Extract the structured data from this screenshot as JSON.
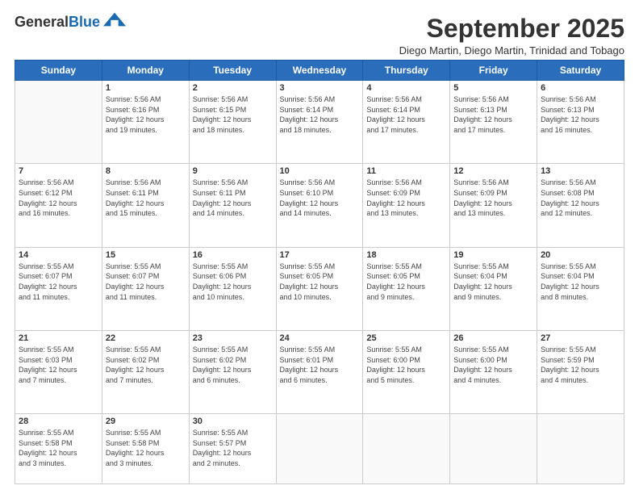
{
  "header": {
    "logo_general": "General",
    "logo_blue": "Blue",
    "month_title": "September 2025",
    "subtitle": "Diego Martin, Diego Martin, Trinidad and Tobago"
  },
  "weekdays": [
    "Sunday",
    "Monday",
    "Tuesday",
    "Wednesday",
    "Thursday",
    "Friday",
    "Saturday"
  ],
  "weeks": [
    [
      {
        "day": "",
        "info": ""
      },
      {
        "day": "1",
        "info": "Sunrise: 5:56 AM\nSunset: 6:16 PM\nDaylight: 12 hours\nand 19 minutes."
      },
      {
        "day": "2",
        "info": "Sunrise: 5:56 AM\nSunset: 6:15 PM\nDaylight: 12 hours\nand 18 minutes."
      },
      {
        "day": "3",
        "info": "Sunrise: 5:56 AM\nSunset: 6:14 PM\nDaylight: 12 hours\nand 18 minutes."
      },
      {
        "day": "4",
        "info": "Sunrise: 5:56 AM\nSunset: 6:14 PM\nDaylight: 12 hours\nand 17 minutes."
      },
      {
        "day": "5",
        "info": "Sunrise: 5:56 AM\nSunset: 6:13 PM\nDaylight: 12 hours\nand 17 minutes."
      },
      {
        "day": "6",
        "info": "Sunrise: 5:56 AM\nSunset: 6:13 PM\nDaylight: 12 hours\nand 16 minutes."
      }
    ],
    [
      {
        "day": "7",
        "info": "Sunrise: 5:56 AM\nSunset: 6:12 PM\nDaylight: 12 hours\nand 16 minutes."
      },
      {
        "day": "8",
        "info": "Sunrise: 5:56 AM\nSunset: 6:11 PM\nDaylight: 12 hours\nand 15 minutes."
      },
      {
        "day": "9",
        "info": "Sunrise: 5:56 AM\nSunset: 6:11 PM\nDaylight: 12 hours\nand 14 minutes."
      },
      {
        "day": "10",
        "info": "Sunrise: 5:56 AM\nSunset: 6:10 PM\nDaylight: 12 hours\nand 14 minutes."
      },
      {
        "day": "11",
        "info": "Sunrise: 5:56 AM\nSunset: 6:09 PM\nDaylight: 12 hours\nand 13 minutes."
      },
      {
        "day": "12",
        "info": "Sunrise: 5:56 AM\nSunset: 6:09 PM\nDaylight: 12 hours\nand 13 minutes."
      },
      {
        "day": "13",
        "info": "Sunrise: 5:56 AM\nSunset: 6:08 PM\nDaylight: 12 hours\nand 12 minutes."
      }
    ],
    [
      {
        "day": "14",
        "info": "Sunrise: 5:55 AM\nSunset: 6:07 PM\nDaylight: 12 hours\nand 11 minutes."
      },
      {
        "day": "15",
        "info": "Sunrise: 5:55 AM\nSunset: 6:07 PM\nDaylight: 12 hours\nand 11 minutes."
      },
      {
        "day": "16",
        "info": "Sunrise: 5:55 AM\nSunset: 6:06 PM\nDaylight: 12 hours\nand 10 minutes."
      },
      {
        "day": "17",
        "info": "Sunrise: 5:55 AM\nSunset: 6:05 PM\nDaylight: 12 hours\nand 10 minutes."
      },
      {
        "day": "18",
        "info": "Sunrise: 5:55 AM\nSunset: 6:05 PM\nDaylight: 12 hours\nand 9 minutes."
      },
      {
        "day": "19",
        "info": "Sunrise: 5:55 AM\nSunset: 6:04 PM\nDaylight: 12 hours\nand 9 minutes."
      },
      {
        "day": "20",
        "info": "Sunrise: 5:55 AM\nSunset: 6:04 PM\nDaylight: 12 hours\nand 8 minutes."
      }
    ],
    [
      {
        "day": "21",
        "info": "Sunrise: 5:55 AM\nSunset: 6:03 PM\nDaylight: 12 hours\nand 7 minutes."
      },
      {
        "day": "22",
        "info": "Sunrise: 5:55 AM\nSunset: 6:02 PM\nDaylight: 12 hours\nand 7 minutes."
      },
      {
        "day": "23",
        "info": "Sunrise: 5:55 AM\nSunset: 6:02 PM\nDaylight: 12 hours\nand 6 minutes."
      },
      {
        "day": "24",
        "info": "Sunrise: 5:55 AM\nSunset: 6:01 PM\nDaylight: 12 hours\nand 6 minutes."
      },
      {
        "day": "25",
        "info": "Sunrise: 5:55 AM\nSunset: 6:00 PM\nDaylight: 12 hours\nand 5 minutes."
      },
      {
        "day": "26",
        "info": "Sunrise: 5:55 AM\nSunset: 6:00 PM\nDaylight: 12 hours\nand 4 minutes."
      },
      {
        "day": "27",
        "info": "Sunrise: 5:55 AM\nSunset: 5:59 PM\nDaylight: 12 hours\nand 4 minutes."
      }
    ],
    [
      {
        "day": "28",
        "info": "Sunrise: 5:55 AM\nSunset: 5:58 PM\nDaylight: 12 hours\nand 3 minutes."
      },
      {
        "day": "29",
        "info": "Sunrise: 5:55 AM\nSunset: 5:58 PM\nDaylight: 12 hours\nand 3 minutes."
      },
      {
        "day": "30",
        "info": "Sunrise: 5:55 AM\nSunset: 5:57 PM\nDaylight: 12 hours\nand 2 minutes."
      },
      {
        "day": "",
        "info": ""
      },
      {
        "day": "",
        "info": ""
      },
      {
        "day": "",
        "info": ""
      },
      {
        "day": "",
        "info": ""
      }
    ]
  ]
}
